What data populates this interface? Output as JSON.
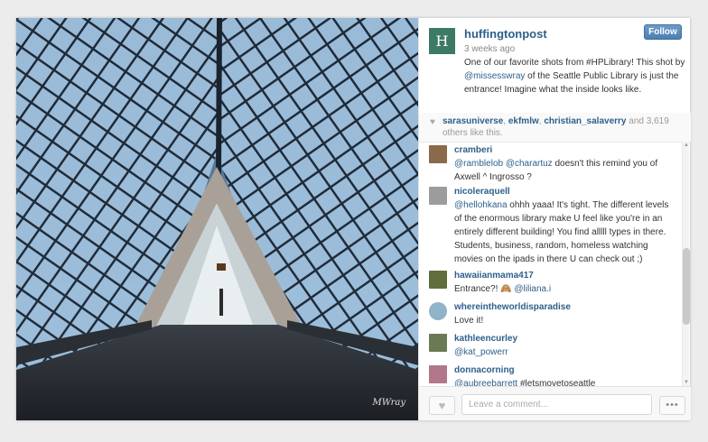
{
  "photo": {
    "watermark": "MWray"
  },
  "post": {
    "avatar_letter": "H",
    "username": "huffingtonpost",
    "time": "3 weeks ago",
    "follow_label": "Follow",
    "caption_before": "One of our favorite shots from #HPLibrary! This shot by ",
    "caption_mention": "@missesswray",
    "caption_after": " of the Seattle Public Library is just the entrance! Imagine what the inside looks like."
  },
  "likes": {
    "user1": "sarasuniverse",
    "sep1": ", ",
    "user2": "ekfmlw",
    "sep2": ", ",
    "user3": "christian_salaverry",
    "and_text": " and ",
    "count": "3,619",
    "suffix": " others like this."
  },
  "comments": [
    {
      "user": "cramberi",
      "mention": "@ramblelob @charartuz",
      "text": " doesn't this remind you of Axwell ^ Ingrosso ?",
      "avatar_color": "#8a6a4a"
    },
    {
      "user": "nicoleraquell",
      "mention": "@hellohkana",
      "text": " ohhh yaaa! It's tight. The different levels of the enormous library make U feel like you're in an entirely different building! You find alllll types in there. Students, business, random, homeless watching movies on the ipads in there U can check out ;)",
      "avatar_color": "#9c9c9c"
    },
    {
      "user": "hawaiianmama417",
      "mention": "",
      "text": "Entrance?! 🙈 ",
      "mention2": "@liliana.i",
      "avatar_color": "#5f6e3a"
    },
    {
      "user": "whereintheworldisparadise",
      "mention": "",
      "text": "Love it!",
      "avatar_color": "#8fb3c9"
    },
    {
      "user": "kathleencurley",
      "mention": "@kat_powerr",
      "text": "",
      "avatar_color": "#6b7a54"
    },
    {
      "user": "donnacorning",
      "mention": "@aubreebarrett",
      "text": " #letsmovetoseattle",
      "avatar_color": "#b0788a"
    }
  ],
  "footer": {
    "comment_placeholder": "Leave a comment...",
    "more_label": "•••"
  },
  "colors": {
    "link": "#2d5f8b",
    "follow": "#4b7fb3",
    "avatar": "#3d7a66"
  }
}
